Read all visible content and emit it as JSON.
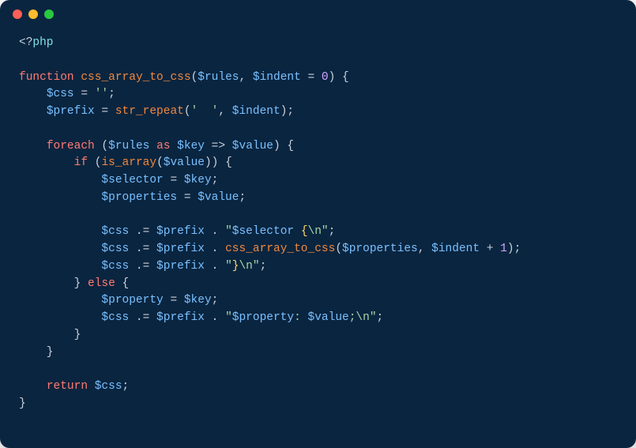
{
  "window": {
    "traffic_lights": {
      "close": "#ff5f57",
      "minimize": "#febc2e",
      "zoom": "#28c840"
    }
  },
  "code": {
    "lines": [
      [
        {
          "cls": "tok-default",
          "t": "<?"
        },
        {
          "cls": "tok-tag",
          "t": "php"
        }
      ],
      [],
      [
        {
          "cls": "tok-keyword",
          "t": "function"
        },
        {
          "cls": "tok-default",
          "t": " "
        },
        {
          "cls": "tok-func",
          "t": "css_array_to_css"
        },
        {
          "cls": "tok-default",
          "t": "("
        },
        {
          "cls": "tok-var",
          "t": "$rules"
        },
        {
          "cls": "tok-default",
          "t": ", "
        },
        {
          "cls": "tok-var",
          "t": "$indent"
        },
        {
          "cls": "tok-default",
          "t": " = "
        },
        {
          "cls": "tok-number",
          "t": "0"
        },
        {
          "cls": "tok-default",
          "t": ") {"
        }
      ],
      [
        {
          "cls": "tok-default",
          "t": "    "
        },
        {
          "cls": "tok-var",
          "t": "$css"
        },
        {
          "cls": "tok-default",
          "t": " = "
        },
        {
          "cls": "tok-string",
          "t": "''"
        },
        {
          "cls": "tok-default",
          "t": ";"
        }
      ],
      [
        {
          "cls": "tok-default",
          "t": "    "
        },
        {
          "cls": "tok-var",
          "t": "$prefix"
        },
        {
          "cls": "tok-default",
          "t": " = "
        },
        {
          "cls": "tok-func",
          "t": "str_repeat"
        },
        {
          "cls": "tok-default",
          "t": "("
        },
        {
          "cls": "tok-string",
          "t": "'  '"
        },
        {
          "cls": "tok-default",
          "t": ", "
        },
        {
          "cls": "tok-var",
          "t": "$indent"
        },
        {
          "cls": "tok-default",
          "t": ");"
        }
      ],
      [],
      [
        {
          "cls": "tok-default",
          "t": "    "
        },
        {
          "cls": "tok-keyword",
          "t": "foreach"
        },
        {
          "cls": "tok-default",
          "t": " ("
        },
        {
          "cls": "tok-var",
          "t": "$rules"
        },
        {
          "cls": "tok-default",
          "t": " "
        },
        {
          "cls": "tok-keyword",
          "t": "as"
        },
        {
          "cls": "tok-default",
          "t": " "
        },
        {
          "cls": "tok-var",
          "t": "$key"
        },
        {
          "cls": "tok-default",
          "t": " => "
        },
        {
          "cls": "tok-var",
          "t": "$value"
        },
        {
          "cls": "tok-default",
          "t": ") {"
        }
      ],
      [
        {
          "cls": "tok-default",
          "t": "        "
        },
        {
          "cls": "tok-keyword",
          "t": "if"
        },
        {
          "cls": "tok-default",
          "t": " ("
        },
        {
          "cls": "tok-func",
          "t": "is_array"
        },
        {
          "cls": "tok-default",
          "t": "("
        },
        {
          "cls": "tok-var",
          "t": "$value"
        },
        {
          "cls": "tok-default",
          "t": ")) {"
        }
      ],
      [
        {
          "cls": "tok-default",
          "t": "            "
        },
        {
          "cls": "tok-var",
          "t": "$selector"
        },
        {
          "cls": "tok-default",
          "t": " = "
        },
        {
          "cls": "tok-var",
          "t": "$key"
        },
        {
          "cls": "tok-default",
          "t": ";"
        }
      ],
      [
        {
          "cls": "tok-default",
          "t": "            "
        },
        {
          "cls": "tok-var",
          "t": "$properties"
        },
        {
          "cls": "tok-default",
          "t": " = "
        },
        {
          "cls": "tok-var",
          "t": "$value"
        },
        {
          "cls": "tok-default",
          "t": ";"
        }
      ],
      [],
      [
        {
          "cls": "tok-default",
          "t": "            "
        },
        {
          "cls": "tok-var",
          "t": "$css"
        },
        {
          "cls": "tok-default",
          "t": " .= "
        },
        {
          "cls": "tok-var",
          "t": "$prefix"
        },
        {
          "cls": "tok-default",
          "t": " . "
        },
        {
          "cls": "tok-string",
          "t": "\""
        },
        {
          "cls": "tok-var",
          "t": "$selector"
        },
        {
          "cls": "tok-string",
          "t": " "
        },
        {
          "cls": "tok-yellow",
          "t": "{"
        },
        {
          "cls": "tok-string",
          "t": "\\n\""
        },
        {
          "cls": "tok-default",
          "t": ";"
        }
      ],
      [
        {
          "cls": "tok-default",
          "t": "            "
        },
        {
          "cls": "tok-var",
          "t": "$css"
        },
        {
          "cls": "tok-default",
          "t": " .= "
        },
        {
          "cls": "tok-var",
          "t": "$prefix"
        },
        {
          "cls": "tok-default",
          "t": " . "
        },
        {
          "cls": "tok-func",
          "t": "css_array_to_css"
        },
        {
          "cls": "tok-default",
          "t": "("
        },
        {
          "cls": "tok-var",
          "t": "$properties"
        },
        {
          "cls": "tok-default",
          "t": ", "
        },
        {
          "cls": "tok-var",
          "t": "$indent"
        },
        {
          "cls": "tok-default",
          "t": " + "
        },
        {
          "cls": "tok-number",
          "t": "1"
        },
        {
          "cls": "tok-default",
          "t": ");"
        }
      ],
      [
        {
          "cls": "tok-default",
          "t": "            "
        },
        {
          "cls": "tok-var",
          "t": "$css"
        },
        {
          "cls": "tok-default",
          "t": " .= "
        },
        {
          "cls": "tok-var",
          "t": "$prefix"
        },
        {
          "cls": "tok-default",
          "t": " . "
        },
        {
          "cls": "tok-string",
          "t": "\""
        },
        {
          "cls": "tok-yellow",
          "t": "}"
        },
        {
          "cls": "tok-string",
          "t": "\\n\""
        },
        {
          "cls": "tok-default",
          "t": ";"
        }
      ],
      [
        {
          "cls": "tok-default",
          "t": "        } "
        },
        {
          "cls": "tok-keyword",
          "t": "else"
        },
        {
          "cls": "tok-default",
          "t": " {"
        }
      ],
      [
        {
          "cls": "tok-default",
          "t": "            "
        },
        {
          "cls": "tok-var",
          "t": "$property"
        },
        {
          "cls": "tok-default",
          "t": " = "
        },
        {
          "cls": "tok-var",
          "t": "$key"
        },
        {
          "cls": "tok-default",
          "t": ";"
        }
      ],
      [
        {
          "cls": "tok-default",
          "t": "            "
        },
        {
          "cls": "tok-var",
          "t": "$css"
        },
        {
          "cls": "tok-default",
          "t": " .= "
        },
        {
          "cls": "tok-var",
          "t": "$prefix"
        },
        {
          "cls": "tok-default",
          "t": " . "
        },
        {
          "cls": "tok-string",
          "t": "\""
        },
        {
          "cls": "tok-var",
          "t": "$property"
        },
        {
          "cls": "tok-string",
          "t": ": "
        },
        {
          "cls": "tok-var",
          "t": "$value"
        },
        {
          "cls": "tok-string",
          "t": ";\\n\""
        },
        {
          "cls": "tok-default",
          "t": ";"
        }
      ],
      [
        {
          "cls": "tok-default",
          "t": "        }"
        }
      ],
      [
        {
          "cls": "tok-default",
          "t": "    }"
        }
      ],
      [],
      [
        {
          "cls": "tok-default",
          "t": "    "
        },
        {
          "cls": "tok-keyword",
          "t": "return"
        },
        {
          "cls": "tok-default",
          "t": " "
        },
        {
          "cls": "tok-var",
          "t": "$css"
        },
        {
          "cls": "tok-default",
          "t": ";"
        }
      ],
      [
        {
          "cls": "tok-default",
          "t": "}"
        }
      ]
    ]
  }
}
